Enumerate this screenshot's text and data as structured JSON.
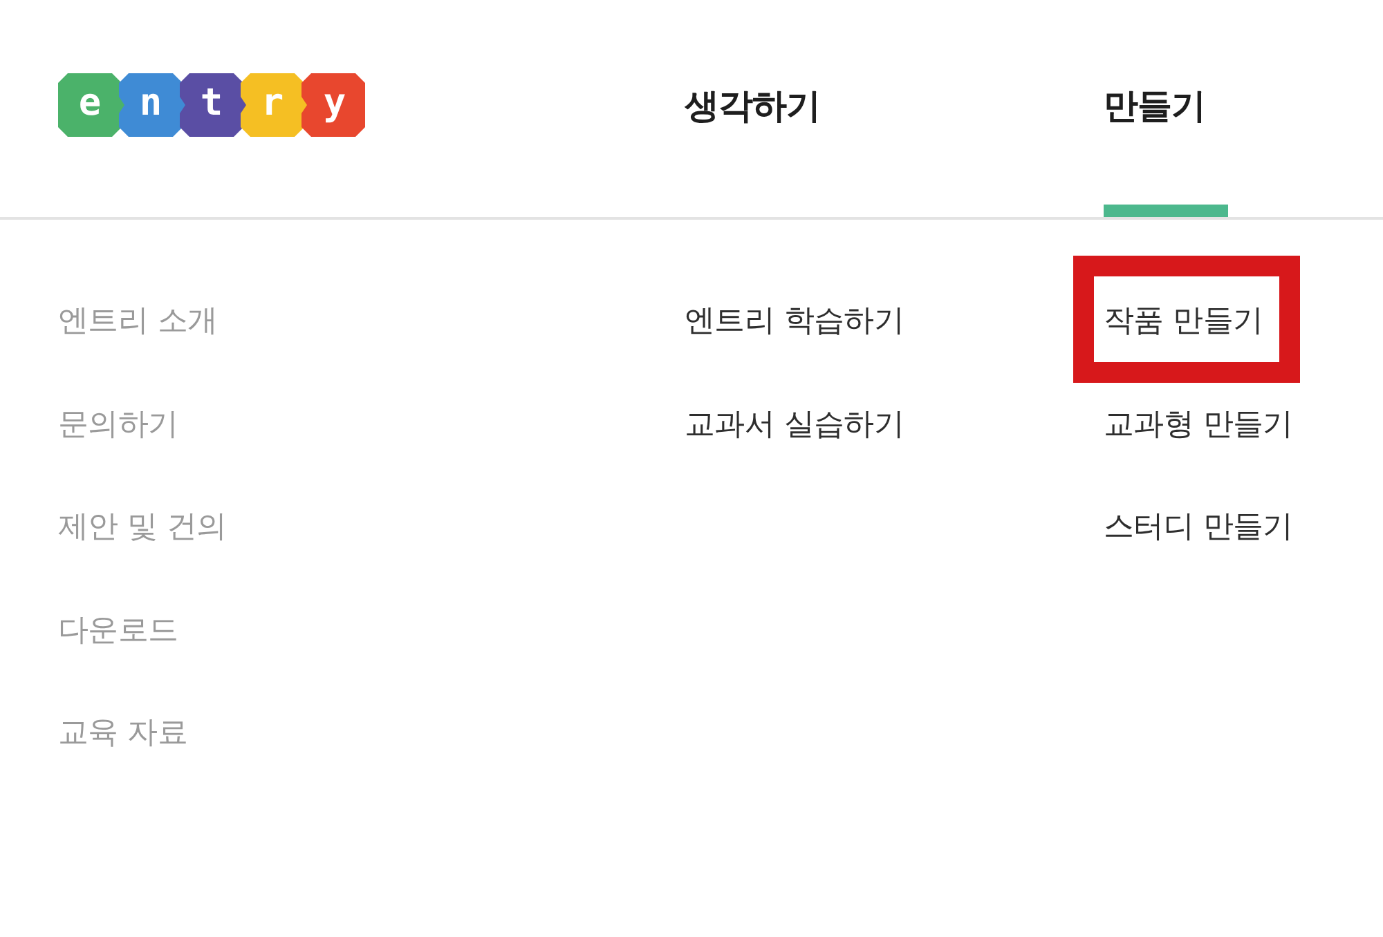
{
  "logo": {
    "letters": [
      {
        "char": "e",
        "color": "#4bb26a"
      },
      {
        "char": "n",
        "color": "#3f8bd5"
      },
      {
        "char": "t",
        "color": "#5a4ea4"
      },
      {
        "char": "r",
        "color": "#f5bf23"
      },
      {
        "char": "y",
        "color": "#e8472e"
      }
    ]
  },
  "nav_tabs": [
    {
      "label": "생각하기",
      "selected": false
    },
    {
      "label": "만들기",
      "selected": true
    }
  ],
  "menu_columns": [
    {
      "muted": true,
      "items": [
        {
          "label": "엔트리 소개",
          "highlighted": false
        },
        {
          "label": "문의하기",
          "highlighted": false
        },
        {
          "label": "제안 및 건의",
          "highlighted": false
        },
        {
          "label": "다운로드",
          "highlighted": false
        },
        {
          "label": "교육 자료",
          "highlighted": false
        }
      ]
    },
    {
      "muted": false,
      "items": [
        {
          "label": "엔트리 학습하기",
          "highlighted": false
        },
        {
          "label": "교과서 실습하기",
          "highlighted": false
        }
      ]
    },
    {
      "muted": false,
      "items": [
        {
          "label": "작품 만들기",
          "highlighted": true
        },
        {
          "label": "교과형 만들기",
          "highlighted": false
        },
        {
          "label": "스터디 만들기",
          "highlighted": false
        }
      ]
    }
  ]
}
